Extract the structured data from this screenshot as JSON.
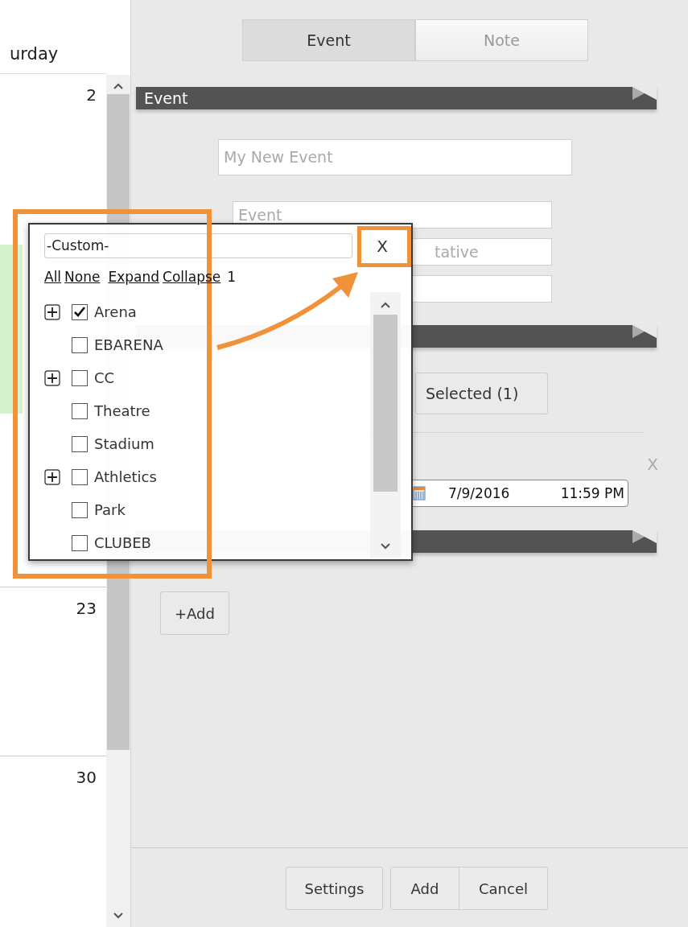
{
  "calendar": {
    "day_header": "urday",
    "days": [
      {
        "number": "2",
        "has_event": true
      },
      {
        "number": "23",
        "has_event": false
      },
      {
        "number": "30",
        "has_event": false
      }
    ]
  },
  "mode_tabs": [
    {
      "label": "Event",
      "selected": true
    },
    {
      "label": "Note",
      "selected": false
    }
  ],
  "section_title": "Event",
  "fields": [
    {
      "placeholder": "My New Event"
    },
    {
      "placeholder": "Event"
    },
    {
      "placeholder": "tative"
    }
  ],
  "selected_button": "Selected (1)",
  "remove_label": "X",
  "date_end": {
    "date": "7/9/2016",
    "time": "11:59 PM"
  },
  "add_button": "+Add",
  "footer_buttons": [
    "Settings",
    "Add",
    "Cancel"
  ],
  "popup": {
    "value": "-Custom-",
    "close": "X",
    "links": [
      "All",
      "None",
      "Expand",
      "Collapse"
    ],
    "count": "1",
    "items": [
      {
        "label": "Arena",
        "expandable": true,
        "checked": true
      },
      {
        "label": "EBARENA",
        "expandable": false,
        "checked": false
      },
      {
        "label": "CC",
        "expandable": true,
        "checked": false
      },
      {
        "label": "Theatre",
        "expandable": false,
        "checked": false
      },
      {
        "label": "Stadium",
        "expandable": false,
        "checked": false
      },
      {
        "label": "Athletics",
        "expandable": true,
        "checked": false
      },
      {
        "label": "Park",
        "expandable": false,
        "checked": false
      },
      {
        "label": "CLUBEB",
        "expandable": false,
        "checked": false
      }
    ]
  }
}
